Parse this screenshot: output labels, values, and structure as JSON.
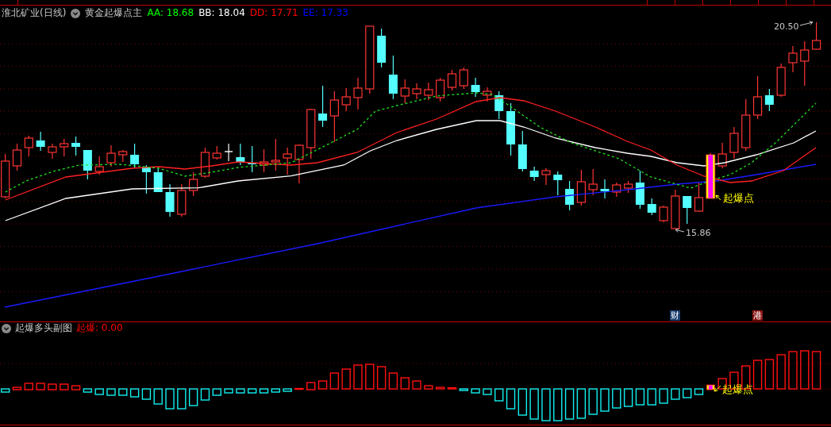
{
  "header": {
    "security": "淮北矿业(日线)",
    "indicator": "黄金起爆点主",
    "values": [
      {
        "text": "AA: 18.68",
        "color": "#00ff00"
      },
      {
        "text": "BB: 18.04",
        "color": "#ffffff"
      },
      {
        "text": "DD: 17.71",
        "color": "#ff0000"
      },
      {
        "text": "EE: 17.33",
        "color": "#0000ff"
      }
    ]
  },
  "main_chart": {
    "high_label": "20.50",
    "low_label": "15.86",
    "signal_label": "起爆点",
    "event_markers": [
      {
        "text": "财",
        "color": "#1c3f6e"
      },
      {
        "text": "港",
        "color": "#8a1414"
      }
    ]
  },
  "sub_chart": {
    "title": "起爆多头副图",
    "values": [
      {
        "text": "起爆: 0.00",
        "color": "#ff0000"
      }
    ],
    "signal_label": "起爆点"
  }
}
